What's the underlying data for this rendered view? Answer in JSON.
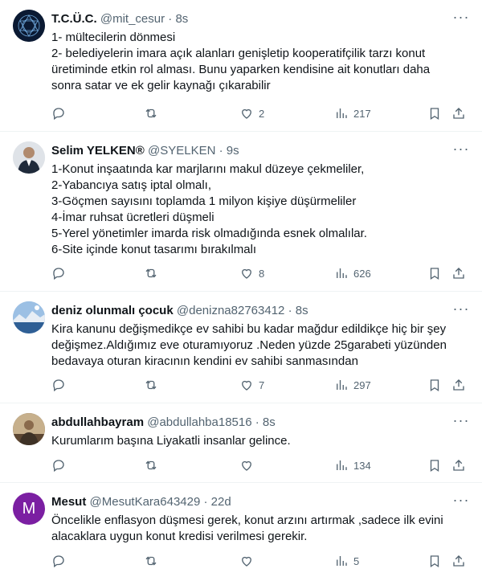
{
  "tweets": [
    {
      "name": "T.C.Ü.C.",
      "handle": "@mit_cesur",
      "dot": "·",
      "time": "8s",
      "lines": [
        "1- mültecilerin dönmesi",
        "2- belediyelerin imara açık alanları genişletip kooperatifçilik tarzı konut",
        "üretiminde etkin rol alması. Bunu yaparken kendisine ait konutları daha",
        "sonra satar ve ek gelir kaynağı çıkarabilir"
      ],
      "replies": "",
      "retweets": "",
      "likes": "2",
      "views": "217"
    },
    {
      "name": "Selim YELKEN®",
      "handle": "@SYELKEN",
      "dot": "·",
      "time": "9s",
      "lines": [
        "1-Konut inşaatında kar marjlarını makul düzeye çekmeliler,",
        "2-Yabancıya satış iptal olmalı,",
        "3-Göçmen sayısını toplamda 1 milyon kişiye düşürmeliler",
        "4-İmar ruhsat ücretleri düşmeli",
        "5-Yerel yönetimler imarda risk olmadığında esnek olmalılar.",
        "6-Site içinde konut tasarımı bırakılmalı"
      ],
      "replies": "",
      "retweets": "",
      "likes": "8",
      "views": "626"
    },
    {
      "name": "deniz olunmalı çocuk",
      "handle": "@denizna82763412",
      "dot": "·",
      "time": "8s",
      "lines": [
        "Kira kanunu değişmedikçe ev sahibi bu kadar mağdur edildikçe  hiç bir şey",
        "değişmez.Aldığımız eve oturamıyoruz .Neden yüzde 25garabeti yüzünden",
        "bedavaya oturan kiracının kendini ev sahibi sanmasından"
      ],
      "replies": "",
      "retweets": "",
      "likes": "7",
      "views": "297"
    },
    {
      "name": "abdullahbayram",
      "handle": "@abdullahba18516",
      "dot": "·",
      "time": "8s",
      "lines": [
        "Kurumlarım başına Liyakatli insanlar gelince."
      ],
      "replies": "",
      "retweets": "",
      "likes": "",
      "views": "134"
    },
    {
      "name": "Mesut",
      "handle": "@MesutKara643429",
      "dot": "·",
      "time": "22d",
      "avatar_letter": "M",
      "lines": [
        "Öncelikle enflasyon düşmesi gerek, konut arzını artırmak ,sadece ilk evini",
        "alacaklara uygun konut kredisi verilmesi gerekir."
      ],
      "replies": "",
      "retweets": "",
      "likes": "",
      "views": "5"
    }
  ],
  "colors": {
    "text": "#0f1419",
    "secondary": "#536471",
    "divider": "#eff3f4",
    "avatar_purple": "#7b1fa2"
  }
}
